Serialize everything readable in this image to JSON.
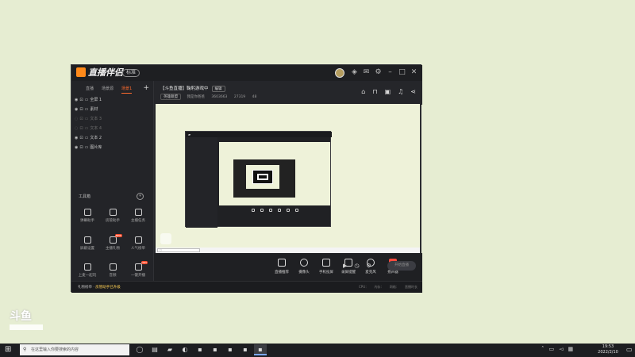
{
  "app": {
    "version": "标准",
    "titlebar_icons": [
      "shirt-icon",
      "mail-icon",
      "settings-icon",
      "minimize-icon",
      "maximize-icon",
      "close-icon"
    ]
  },
  "sidebar": {
    "tabs": [
      "直播",
      "场景源",
      "场景1"
    ],
    "sources": [
      {
        "label": "全屏 1",
        "enabled": true
      },
      {
        "label": "素材",
        "enabled": true
      },
      {
        "label": "文本 3",
        "enabled": false
      },
      {
        "label": "文本 4",
        "enabled": false
      },
      {
        "label": "文本 2",
        "enabled": true
      },
      {
        "label": "图片库",
        "enabled": true
      }
    ],
    "tools_header": "工具箱",
    "tools_toggle": "▾",
    "tools": [
      {
        "label": "弹幕助手",
        "icon": "danmaku-icon"
      },
      {
        "label": "房管助手",
        "icon": "person-icon"
      },
      {
        "label": "主播任务",
        "icon": "task-icon"
      },
      {
        "label": "屏蔽设置",
        "icon": "shield-icon"
      },
      {
        "label": "主播礼物",
        "icon": "gift-icon",
        "badge": "NEW"
      },
      {
        "label": "人气榜单",
        "icon": "fire-icon"
      },
      {
        "label": "上麦一起玩",
        "icon": "game-icon"
      },
      {
        "label": "音频",
        "icon": "audio-icon"
      },
      {
        "label": "一键开播",
        "icon": "play-icon",
        "badge": "HOT"
      }
    ]
  },
  "broadcast": {
    "title": "【斗鱼直播】鞠躬游戏中",
    "edit_label": "编辑",
    "category": "英雄联盟",
    "meta": [
      "我是你爸爸",
      "3603663",
      "27319",
      "48"
    ]
  },
  "controls": [
    {
      "label": "直播推荐",
      "icon": "screen-icon"
    },
    {
      "label": "摄像头",
      "icon": "camera-icon"
    },
    {
      "label": "手机投屏",
      "icon": "phone-icon"
    },
    {
      "label": "录屏提醒",
      "icon": "record-icon"
    },
    {
      "label": "麦克风",
      "icon": "mic-icon"
    },
    {
      "label": "扬声器",
      "icon": "speaker-icon"
    }
  ],
  "start_button": "开始直播",
  "footer": {
    "left": "礼物榜单",
    "left_highlight": "房管助手已升级",
    "right": [
      "CPU：",
      "内存：",
      "网络：",
      "直播时长"
    ]
  },
  "desktop": {
    "logo": "斗鱼"
  },
  "taskbar": {
    "search_placeholder": "在这里输入你要搜索的内容",
    "time": "19:53",
    "date": "2022/2/10"
  }
}
